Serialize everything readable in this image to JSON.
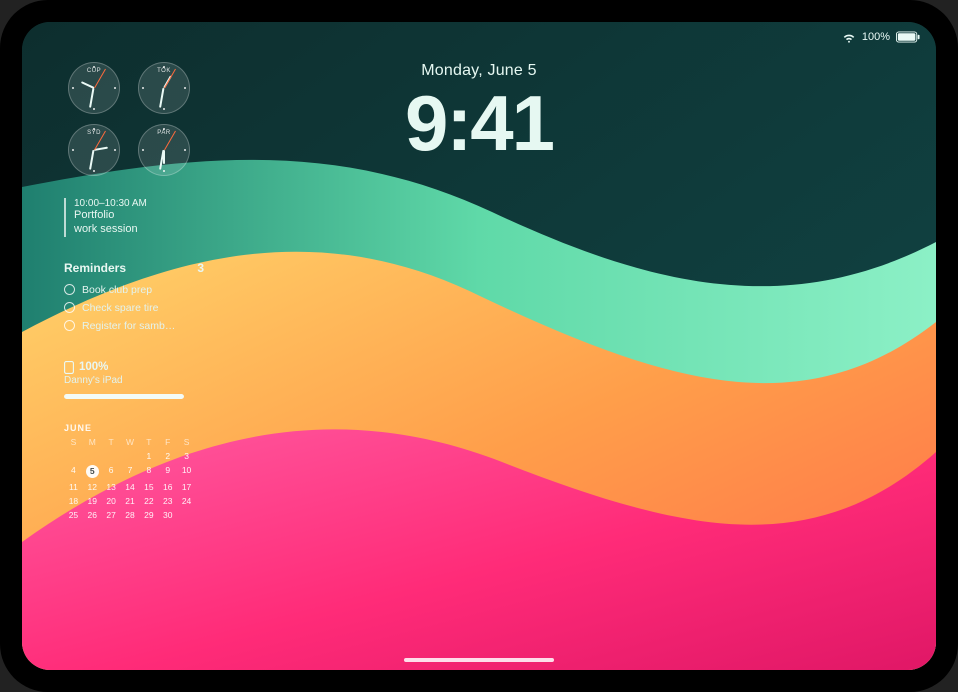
{
  "status_bar": {
    "battery_percent_label": "100%"
  },
  "datetime": {
    "date": "Monday, June 5",
    "time": "9:41"
  },
  "world_clock": {
    "cities": [
      {
        "label": "CUP",
        "hour_angle": -65,
        "min_angle": 190,
        "sec_angle": 30
      },
      {
        "label": "TOK",
        "hour_angle": 30,
        "min_angle": 190,
        "sec_angle": 30
      },
      {
        "label": "SYD",
        "hour_angle": 80,
        "min_angle": 190,
        "sec_angle": 30
      },
      {
        "label": "PAR",
        "hour_angle": 180,
        "min_angle": 190,
        "sec_angle": 30
      }
    ]
  },
  "event": {
    "time_range": "10:00–10:30 AM",
    "title_line1": "Portfolio",
    "title_line2": "work session"
  },
  "reminders": {
    "header": "Reminders",
    "count": "3",
    "items": [
      "Book club prep",
      "Check spare tire",
      "Register for samb…"
    ]
  },
  "battery_widget": {
    "percent_label": "100%",
    "device_name": "Danny's iPad",
    "fill_percent": 100
  },
  "calendar": {
    "month_label": "JUNE",
    "dow": [
      "S",
      "M",
      "T",
      "W",
      "T",
      "F",
      "S"
    ],
    "weeks": [
      [
        null,
        null,
        null,
        null,
        1,
        2,
        3
      ],
      [
        4,
        5,
        6,
        7,
        8,
        9,
        10
      ],
      [
        11,
        12,
        13,
        14,
        15,
        16,
        17
      ],
      [
        18,
        19,
        20,
        21,
        22,
        23,
        24
      ],
      [
        25,
        26,
        27,
        28,
        29,
        30,
        null
      ]
    ],
    "today": 5
  }
}
